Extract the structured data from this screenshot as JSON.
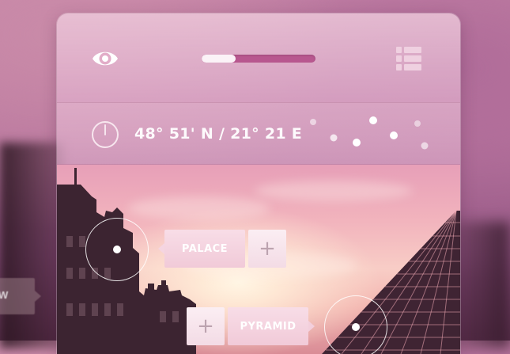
{
  "header": {
    "eye_icon": "eye-icon",
    "menu_icon": "list-menu-icon",
    "progress": {
      "value": 0.3
    }
  },
  "location": {
    "icon": "power-icon",
    "coordinates": "48° 51' N / 21° 21 E"
  },
  "markers": [
    {
      "label": "PALACE",
      "action": "+"
    },
    {
      "label": "PYRAMID",
      "action": "+"
    }
  ],
  "background_tag": {
    "label": "W"
  },
  "colors": {
    "accent": "#b8578f",
    "progress_fill": "#fbf2f7",
    "tag_bg": "#f6d9e3"
  }
}
